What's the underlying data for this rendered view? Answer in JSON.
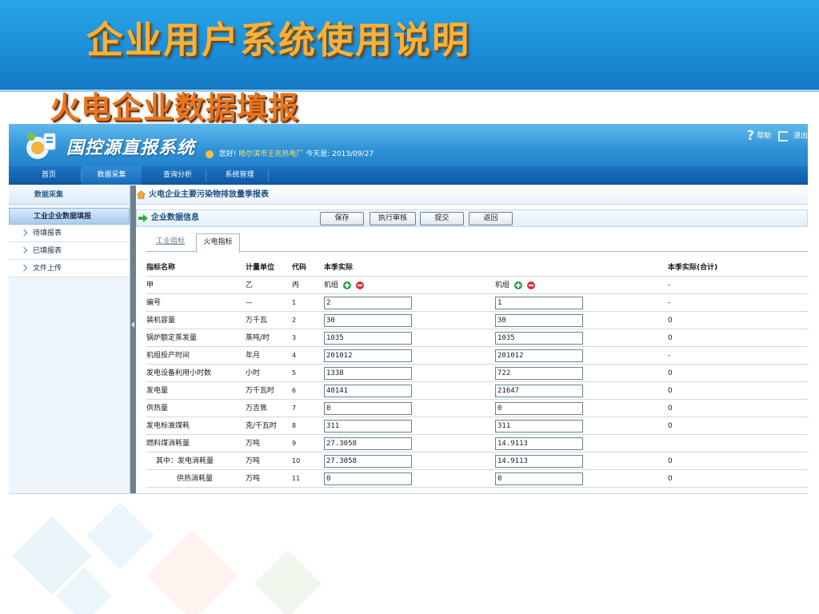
{
  "slide": {
    "title": "企业用户系统使用说明",
    "subtitle": "火电企业数据填报"
  },
  "app": {
    "name": "国控源直报系统",
    "welcome_prefix": "您好!",
    "welcome_user": "哈尔滨市王兆热电厂",
    "welcome_date_label": "今天是:",
    "welcome_date": "2013/09/27",
    "help_label": "帮助",
    "logout_label": "退出"
  },
  "nav": {
    "items": [
      {
        "label": "首页"
      },
      {
        "label": "数据采集"
      },
      {
        "label": "查询分析"
      },
      {
        "label": "系统管理"
      }
    ]
  },
  "sidebar": {
    "header": "数据采集",
    "active": "工业企业数据填报",
    "items": [
      {
        "label": "待填报表"
      },
      {
        "label": "已填报表"
      },
      {
        "label": "文件上传"
      }
    ]
  },
  "main": {
    "report_title": "火电企业主要污染物排放量季报表",
    "info_title": "企业数据信息",
    "buttons": {
      "save": "保存",
      "audit": "执行审核",
      "submit": "提交",
      "back": "返回"
    },
    "tabs": [
      {
        "label": "工业指标"
      },
      {
        "label": "火电指标"
      }
    ]
  },
  "table": {
    "headers": {
      "name": "指标名称",
      "unit": "计量单位",
      "code": "代码",
      "actual": "本季实际",
      "total": "本季实际(合计)"
    },
    "label_row": {
      "name": "甲",
      "unit": "乙",
      "code": "丙",
      "unit1": "机组",
      "unit2": "机组",
      "total": "-"
    },
    "rows": [
      {
        "name": "编号",
        "unit": "—",
        "code": "1",
        "v1": "2",
        "v2": "1",
        "total": "-"
      },
      {
        "name": "装机容量",
        "unit": "万千瓦",
        "code": "2",
        "v1": "30",
        "v2": "30",
        "total": "0"
      },
      {
        "name": "锅炉额定蒸发量",
        "unit": "蒸吨/时",
        "code": "3",
        "v1": "1035",
        "v2": "1035",
        "total": "0"
      },
      {
        "name": "机组投产时间",
        "unit": "年月",
        "code": "4",
        "v1": "201012",
        "v2": "201012",
        "total": "-"
      },
      {
        "name": "发电设备利用小时数",
        "unit": "小时",
        "code": "5",
        "v1": "1338",
        "v2": "722",
        "total": "0"
      },
      {
        "name": "发电量",
        "unit": "万千瓦时",
        "code": "6",
        "v1": "40141",
        "v2": "21647",
        "total": "0"
      },
      {
        "name": "供热量",
        "unit": "万吉焦",
        "code": "7",
        "v1": "0",
        "v2": "0",
        "total": "0"
      },
      {
        "name": "发电标准煤耗",
        "unit": "克/千瓦时",
        "code": "8",
        "v1": "311",
        "v2": "311",
        "total": "0"
      },
      {
        "name": "燃料煤消耗量",
        "unit": "万吨",
        "code": "9",
        "v1": "27.3058",
        "v2": "14.9113",
        "total": ""
      },
      {
        "name": "其中：发电消耗量",
        "unit": "万吨",
        "code": "10",
        "v1": "27.3058",
        "v2": "14.9113",
        "total": "0"
      },
      {
        "name": "供热消耗量",
        "unit": "万吨",
        "code": "11",
        "v1": "0",
        "v2": "0",
        "total": "0"
      }
    ]
  },
  "colors": {
    "banner": "#1c8fd8",
    "title_orange": "#f7b13a",
    "subtitle_orange": "#e8761e",
    "nav_blue": "#0f5aa6"
  }
}
